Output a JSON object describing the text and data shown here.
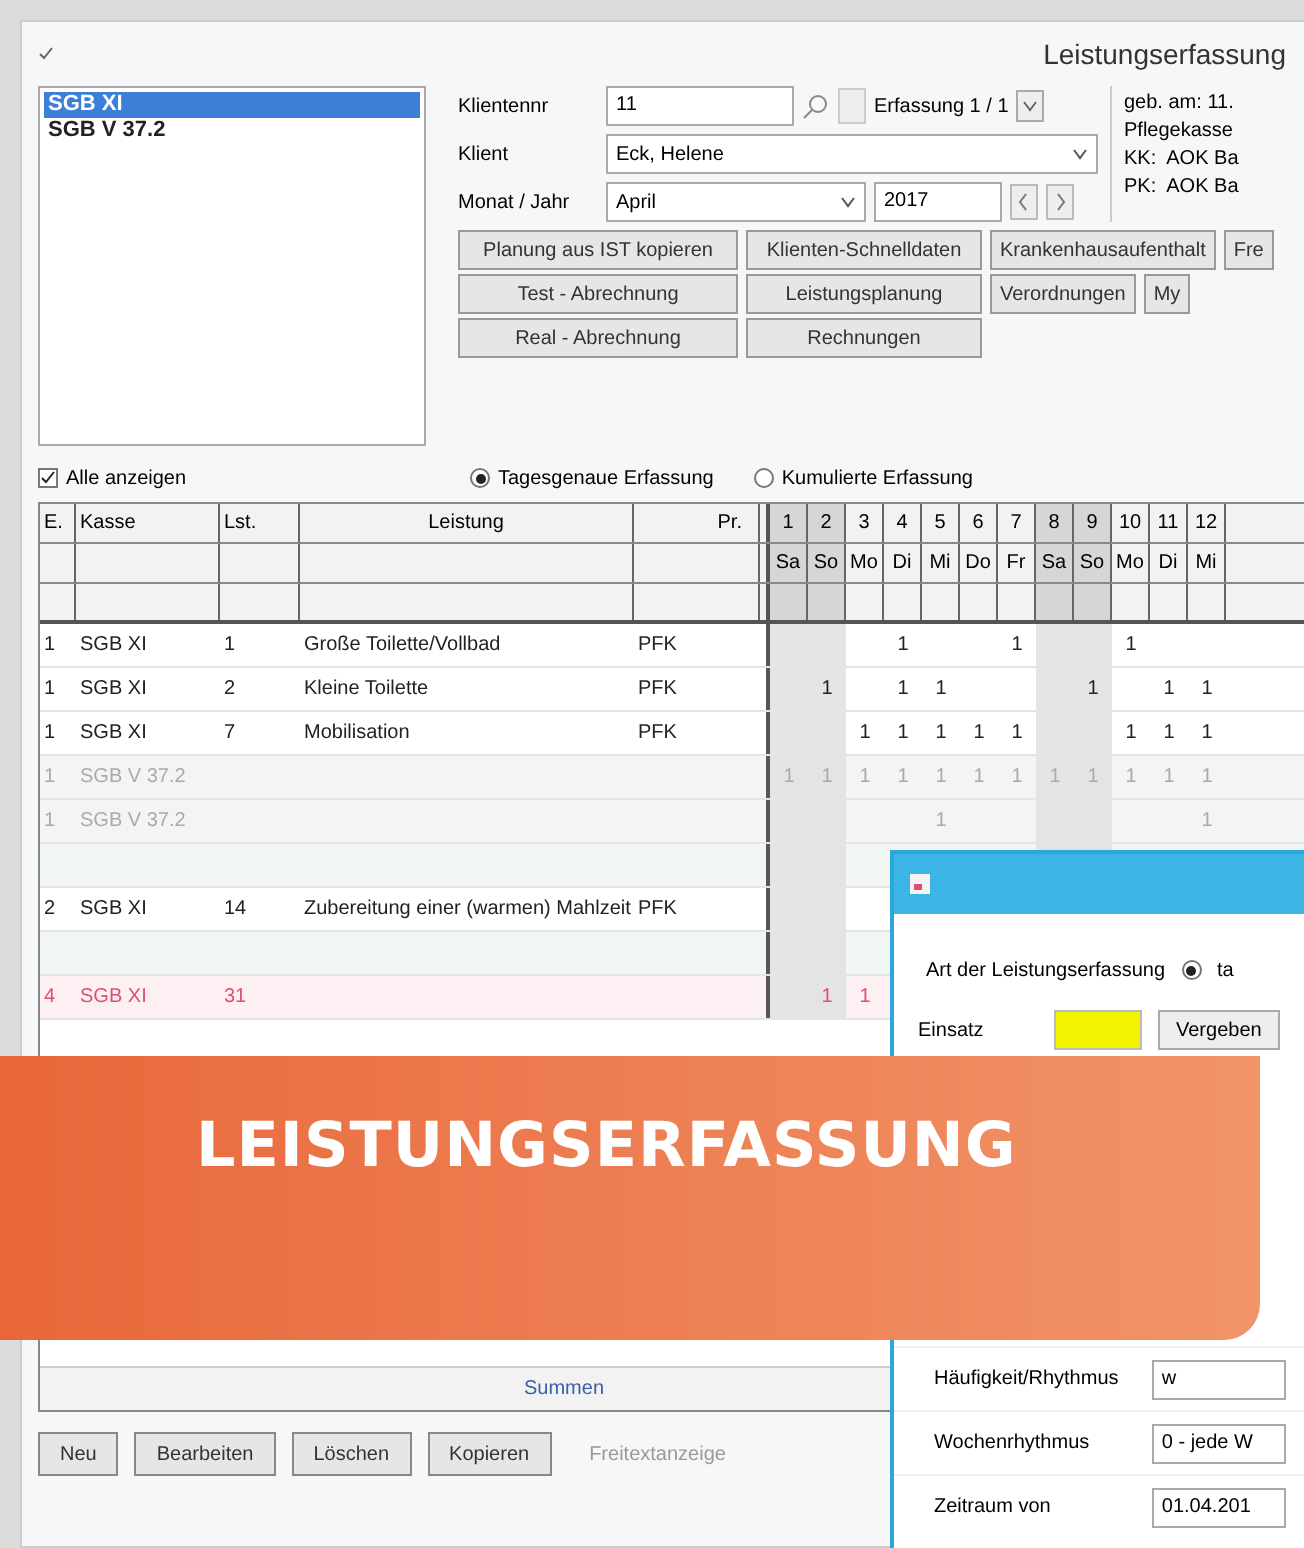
{
  "window": {
    "title": "Leistungserfassung"
  },
  "categories": [
    {
      "label": "SGB XI",
      "selected": true
    },
    {
      "label": "SGB V 37.2",
      "selected": false
    }
  ],
  "form": {
    "client_no": {
      "label": "Klientennr",
      "value": "11"
    },
    "record": "Erfassung 1 / 1",
    "client": {
      "label": "Klient",
      "value": "Eck, Helene"
    },
    "month_year": {
      "label": "Monat / Jahr",
      "month": "April",
      "year": "2017"
    },
    "info": [
      "geb. am: 11.",
      "Pflegekasse",
      "KK:  AOK Ba",
      "PK:  AOK Ba"
    ]
  },
  "action_rows": [
    {
      "buttons": [
        "Planung aus IST kopieren",
        "Klienten-Schnelldaten",
        "Krankenhausaufenthalt",
        "Fre"
      ]
    },
    {
      "buttons": [
        "Test - Abrechnung",
        "Leistungsplanung",
        "Verordnungen",
        "My"
      ]
    },
    {
      "buttons": [
        "Real - Abrechnung",
        "Rechnungen"
      ]
    }
  ],
  "show_all": {
    "label": "Alle anzeigen",
    "checked": true
  },
  "entry_modes": [
    {
      "label": "Tagesgenaue Erfassung",
      "selected": true
    },
    {
      "label": "Kumulierte Erfassung",
      "selected": false
    }
  ],
  "table": {
    "columns": [
      "E.",
      "Kasse",
      "Lst.",
      "Leistung",
      "Pr."
    ],
    "days": [
      {
        "day": "1",
        "weekday": "Sa",
        "weekend": true
      },
      {
        "day": "2",
        "weekday": "So",
        "weekend": true
      },
      {
        "day": "3",
        "weekday": "Mo",
        "weekend": false
      },
      {
        "day": "4",
        "weekday": "Di",
        "weekend": false
      },
      {
        "day": "5",
        "weekday": "Mi",
        "weekend": false
      },
      {
        "day": "6",
        "weekday": "Do",
        "weekend": false
      },
      {
        "day": "7",
        "weekday": "Fr",
        "weekend": false
      },
      {
        "day": "8",
        "weekday": "Sa",
        "weekend": true
      },
      {
        "day": "9",
        "weekday": "So",
        "weekend": true
      },
      {
        "day": "10",
        "weekday": "Mo",
        "weekend": false
      },
      {
        "day": "11",
        "weekday": "Di",
        "weekend": false
      },
      {
        "day": "12",
        "weekday": "Mi",
        "weekend": false
      }
    ],
    "rows": [
      {
        "kind": "normal",
        "cells": [
          "1",
          "SGB XI",
          "1",
          "Große Toilette/Vollbad",
          "PFK"
        ],
        "counts": [
          {
            "blank": true
          },
          {
            "blank": true
          },
          {
            "blank": true
          },
          {
            "text": "1"
          },
          {
            "blank": true
          },
          {
            "blank": true
          },
          {
            "text": "1"
          },
          {
            "blank": true
          },
          {
            "blank": true
          },
          {
            "text": "1"
          }
        ]
      },
      {
        "kind": "normal",
        "cells": [
          "1",
          "SGB XI",
          "2",
          "Kleine Toilette",
          "PFK"
        ],
        "counts": [
          {
            "blank": true
          },
          {
            "text": "1"
          },
          {
            "blank": true
          },
          {
            "text": "1"
          },
          {
            "text": "1"
          },
          {
            "blank": true
          },
          {
            "blank": true
          },
          {
            "blank": true
          },
          {
            "text": "1"
          },
          {
            "blank": true
          },
          {
            "text": "1"
          },
          {
            "text": "1"
          }
        ]
      },
      {
        "kind": "normal",
        "cells": [
          "1",
          "SGB XI",
          "7",
          "Mobilisation",
          "PFK"
        ],
        "counts": [
          {
            "blank": true
          },
          {
            "blank": true
          },
          {
            "text": "1"
          },
          {
            "text": "1"
          },
          {
            "text": "1"
          },
          {
            "text": "1"
          },
          {
            "text": "1"
          },
          {
            "blank": true
          },
          {
            "blank": true
          },
          {
            "text": "1"
          },
          {
            "text": "1"
          },
          {
            "text": "1"
          }
        ]
      },
      {
        "kind": "inactive",
        "cells": [
          "1",
          "SGB V 37.2"
        ],
        "counts": [
          {
            "text": "1"
          },
          {
            "text": "1"
          },
          {
            "text": "1"
          },
          {
            "text": "1"
          },
          {
            "text": "1"
          },
          {
            "text": "1"
          },
          {
            "text": "1"
          },
          {
            "text": "1"
          },
          {
            "text": "1"
          },
          {
            "text": "1"
          },
          {
            "text": "1"
          },
          {
            "text": "1"
          }
        ]
      },
      {
        "kind": "inactive",
        "cells": [
          "1",
          "SGB V 37.2"
        ],
        "counts": [
          {
            "blank": true
          },
          {
            "blank": true
          },
          {
            "blank": true
          },
          {
            "blank": true
          },
          {
            "text": "1"
          },
          {
            "blank": true
          },
          {
            "blank": true
          },
          {
            "blank": true
          },
          {
            "blank": true
          },
          {
            "blank": true
          },
          {
            "blank": true
          },
          {
            "text": "1"
          }
        ]
      },
      {
        "kind": "empty"
      },
      {
        "kind": "normal",
        "cells": [
          "2",
          "SGB XI",
          "14",
          "Zubereitung einer (warmen) Mahlzeit",
          "PFK"
        ]
      },
      {
        "kind": "empty"
      },
      {
        "kind": "warning",
        "cells": [
          "4",
          "SGB XI",
          "31"
        ],
        "counts": [
          {
            "blank": true
          },
          {
            "text": "1"
          },
          {
            "text": "1"
          }
        ]
      }
    ],
    "footer": "Summen"
  },
  "buttons": [
    {
      "label": "Neu",
      "disabled": false
    },
    {
      "label": "Bearbeiten",
      "disabled": false
    },
    {
      "label": "Löschen",
      "disabled": false
    },
    {
      "label": "Kopieren",
      "disabled": false
    },
    {
      "label": "Freitextanzeige",
      "disabled": true
    }
  ],
  "dialog": {
    "mode": {
      "label": "Art der Leistungserfassung",
      "option": "ta",
      "selected": true
    },
    "einsatz": {
      "label": "Einsatz",
      "button": "Vergeben"
    },
    "fields": [
      {
        "label": "Häufigkeit/Rhythmus",
        "value": "w"
      },
      {
        "label": "Wochenrhythmus",
        "value": "0 - jede W"
      },
      {
        "label": "Zeitraum von",
        "value": "01.04.201"
      }
    ]
  },
  "banner": {
    "text": "LEISTUNGSERFASSUNG"
  }
}
